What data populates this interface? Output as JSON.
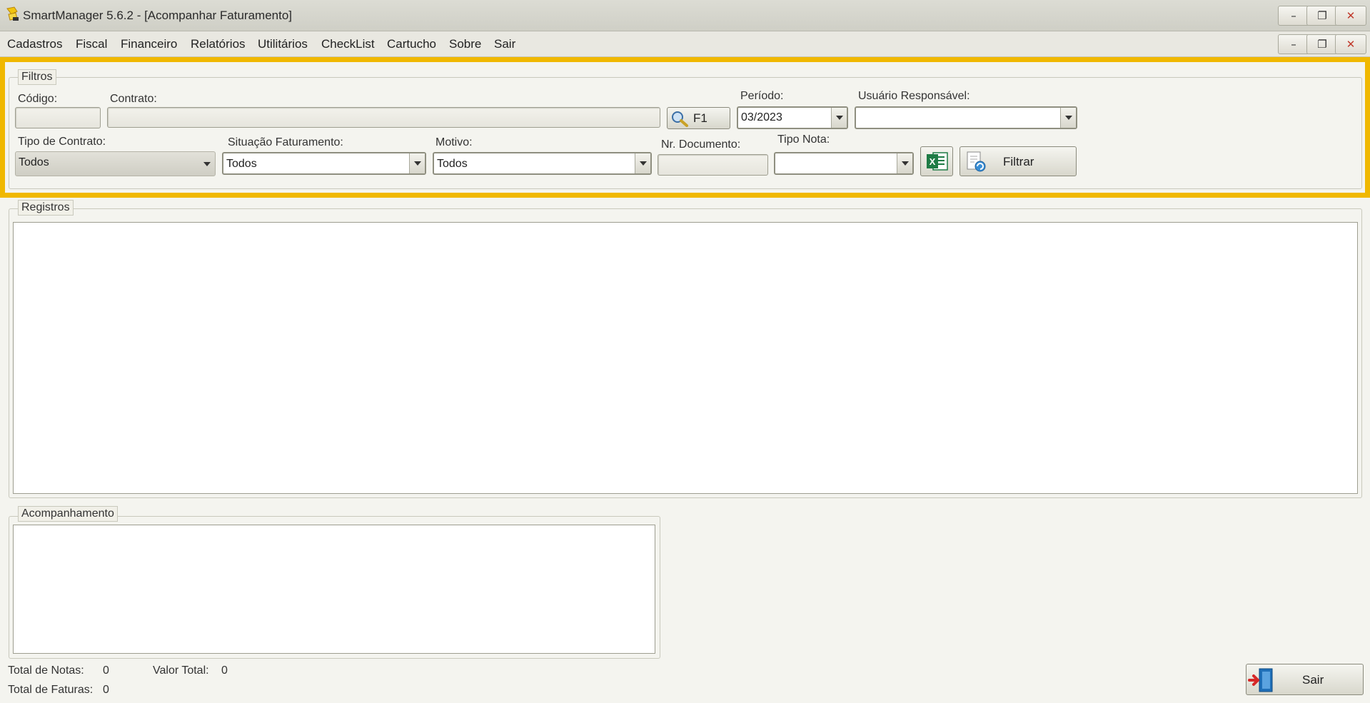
{
  "window": {
    "title": "SmartManager 5.6.2 - [Acompanhar Faturamento]",
    "minimize": "–",
    "restore": "❐",
    "close": "✕"
  },
  "menu": [
    "Cadastros",
    "Fiscal",
    "Financeiro",
    "Relatórios",
    "Utilitários",
    "CheckList",
    "Cartucho",
    "Sobre",
    "Sair"
  ],
  "filtros": {
    "legend": "Filtros",
    "codigo_label": "Código:",
    "codigo_value": "",
    "contrato_label": "Contrato:",
    "contrato_value": "",
    "search_button": "F1",
    "periodo_label": "Período:",
    "periodo_value": "03/2023",
    "usuario_label": "Usuário Responsável:",
    "usuario_value": "",
    "tipo_contrato_label": "Tipo de Contrato:",
    "tipo_contrato_value": "Todos",
    "situacao_label": "Situação Faturamento:",
    "situacao_value": "Todos",
    "motivo_label": "Motivo:",
    "motivo_value": "Todos",
    "nr_documento_label": "Nr. Documento:",
    "nr_documento_value": "",
    "tipo_nota_label": "Tipo Nota:",
    "tipo_nota_value": "",
    "filtrar_button": "Filtrar"
  },
  "registros": {
    "legend": "Registros"
  },
  "acompanhamento": {
    "legend": "Acompanhamento"
  },
  "totals": {
    "total_notas_label": "Total de Notas:",
    "total_notas_value": "0",
    "valor_total_label": "Valor Total:",
    "valor_total_value": "0",
    "total_faturas_label": "Total de Faturas:",
    "total_faturas_value": "0"
  },
  "sair_button": "Sair",
  "colors": {
    "highlight": "#f0b800",
    "excel_green": "#1e7b45"
  }
}
